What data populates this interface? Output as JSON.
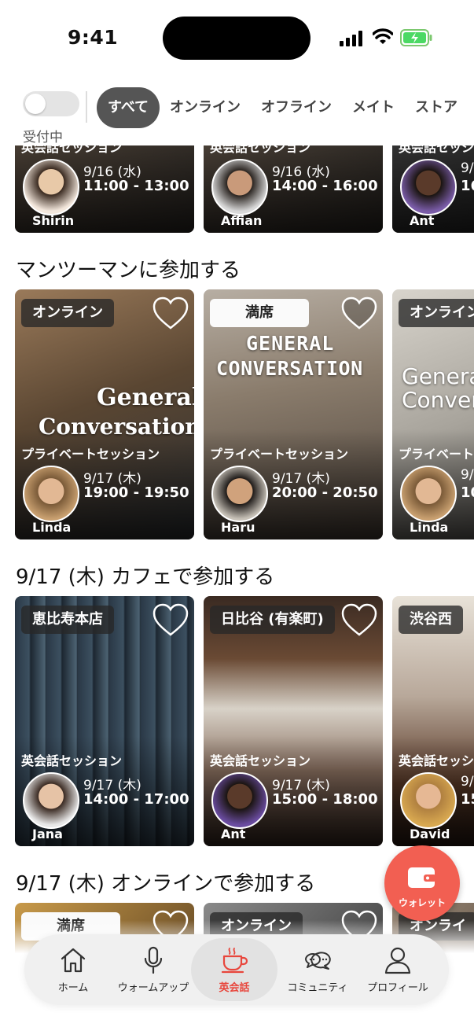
{
  "status_bar": {
    "time": "9:41"
  },
  "filters": {
    "toggle_label": "受付中",
    "tabs": [
      {
        "label": "すべて",
        "active": true
      },
      {
        "label": "オンライン",
        "active": false
      },
      {
        "label": "オフライン",
        "active": false
      },
      {
        "label": "メイト",
        "active": false
      },
      {
        "label": "ストア",
        "active": false
      }
    ]
  },
  "sections": {
    "group_cut": {
      "cards": [
        {
          "type": "英会話セッション",
          "date": "9/16 (水)",
          "time": "11:00 - 13:00",
          "host": "Shirin"
        },
        {
          "type": "英会話セッション",
          "date": "9/16 (水)",
          "time": "14:00 - 16:00",
          "host": "Affian"
        },
        {
          "type": "英会話セッション",
          "date": "9/",
          "time": "16",
          "host": "Ant"
        }
      ]
    },
    "one_on_one": {
      "title": "マンツーマンに参加する",
      "cards": [
        {
          "badge": "オンライン",
          "banner": [
            "General",
            "Conversation"
          ],
          "type": "プライベートセッション",
          "date": "9/17 (木)",
          "time": "19:00 - 19:50",
          "host": "Linda"
        },
        {
          "badge": "満席",
          "banner": [
            "GENERAL",
            "CONVERSATION"
          ],
          "type": "プライベートセッション",
          "date": "9/17 (木)",
          "time": "20:00 - 20:50",
          "host": "Haru"
        },
        {
          "badge": "オンライン",
          "banner": [
            "Genera",
            "Conver"
          ],
          "type": "プライベート",
          "date": "9/",
          "time": "10",
          "host": "Linda"
        }
      ]
    },
    "cafe": {
      "title": "9/17 (木) カフェで参加する",
      "cards": [
        {
          "badge": "恵比寿本店",
          "type": "英会話セッション",
          "date": "9/17 (木)",
          "time": "14:00 - 17:00",
          "host": "Jana"
        },
        {
          "badge": "日比谷 (有楽町)",
          "type": "英会話セッション",
          "date": "9/17 (木)",
          "time": "15:00 - 18:00",
          "host": "Ant"
        },
        {
          "badge": "渋谷西",
          "type": "英会話セッシ",
          "date": "9/",
          "time": "15",
          "host": "David"
        }
      ]
    },
    "online": {
      "title": "9/17 (木) オンラインで参加する",
      "cards": [
        {
          "badge": "満席"
        },
        {
          "badge": "オンライン"
        },
        {
          "badge": "オンライ"
        }
      ]
    }
  },
  "fab": {
    "label": "ウォレット"
  },
  "nav": [
    {
      "label": "ホーム",
      "icon": "home-icon"
    },
    {
      "label": "ウォームアップ",
      "icon": "microphone-icon"
    },
    {
      "label": "英会話",
      "icon": "coffee-cup-icon",
      "active": true
    },
    {
      "label": "コミュニティ",
      "icon": "chat-bubbles-icon"
    },
    {
      "label": "プロフィール",
      "icon": "person-icon"
    }
  ],
  "colors": {
    "accent": "#e8463c",
    "fab": "#f25f52",
    "tab_active": "#555555"
  }
}
